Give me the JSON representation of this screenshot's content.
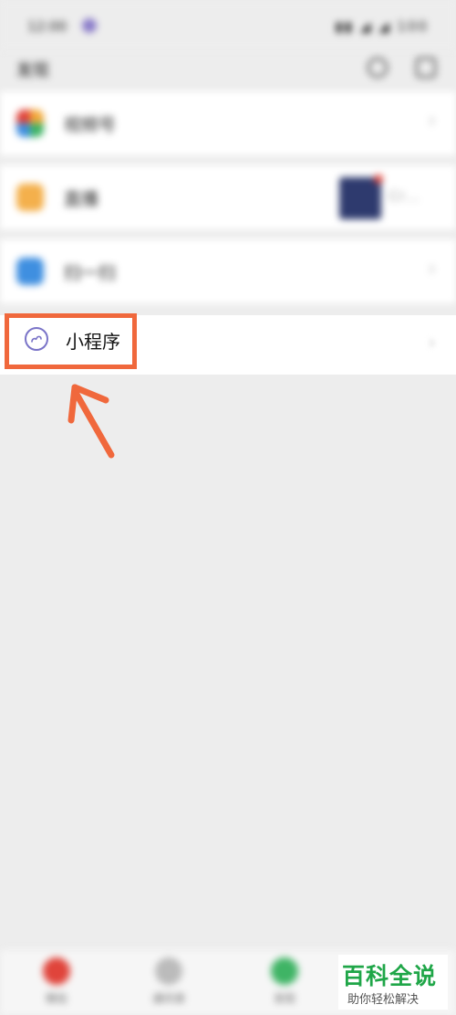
{
  "status_bar": {
    "time": "12:00",
    "right": "▮▮ ◢ ◢ 100"
  },
  "header": {
    "title": "发现"
  },
  "list": [
    {
      "label": "视频号",
      "icon": "channels-icon",
      "color": "#f2a93b"
    },
    {
      "label": "直播",
      "icon": "live-icon",
      "color": "#f4b04c",
      "preview_text": "Cr…"
    },
    {
      "label": "扫一扫",
      "icon": "scan-icon",
      "color": "#3f8fe0"
    }
  ],
  "mini_program": {
    "label": "小程序",
    "icon": "mini-program-icon",
    "accent": "#7a74c8"
  },
  "highlight_color": "#f0683c",
  "tabs": [
    {
      "label": "微信"
    },
    {
      "label": "通讯录"
    },
    {
      "label": "发现"
    }
  ],
  "watermark": {
    "title": "百科全说",
    "subtitle": "助你轻松解决"
  }
}
